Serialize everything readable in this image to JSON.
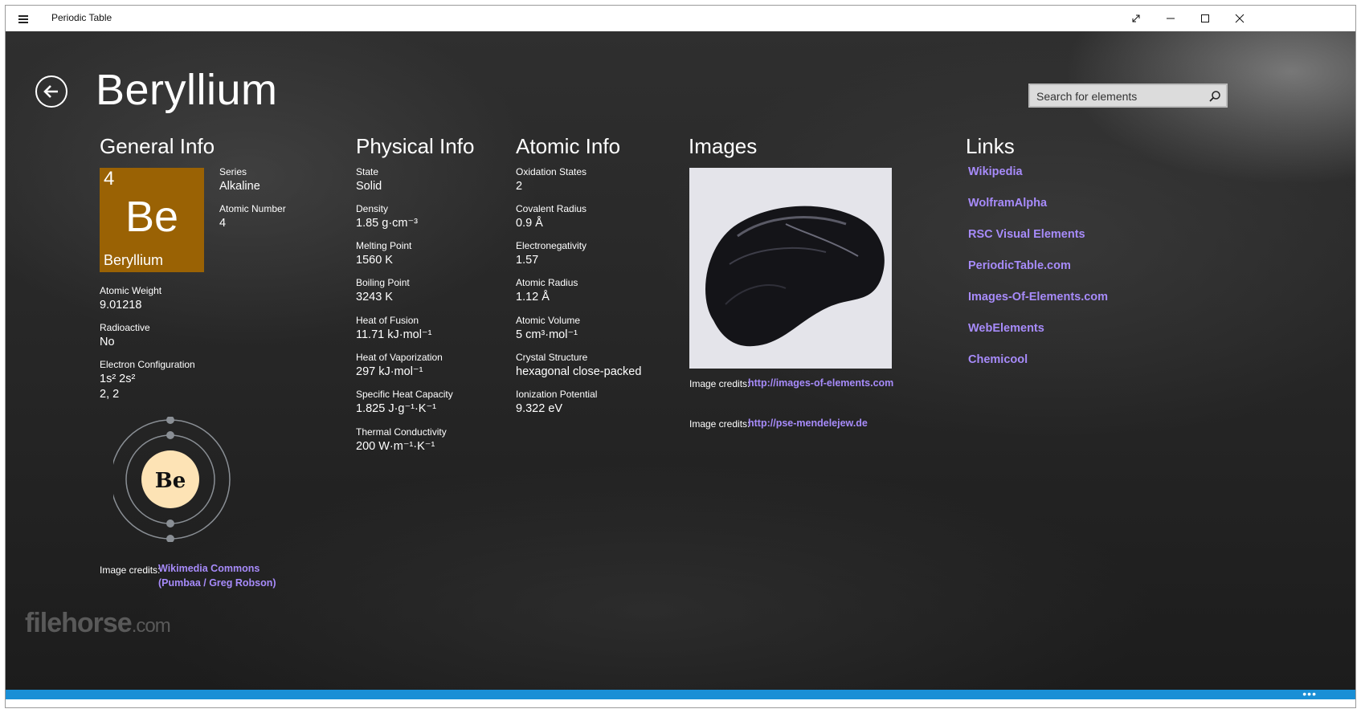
{
  "window": {
    "title": "Periodic Table"
  },
  "page": {
    "title": "Beryllium"
  },
  "search": {
    "placeholder": "Search for elements"
  },
  "sections": {
    "general": "General Info",
    "physical": "Physical Info",
    "atomic": "Atomic Info",
    "images": "Images",
    "links": "Links"
  },
  "tile": {
    "number": "4",
    "symbol": "Be",
    "name": "Beryllium",
    "color": "#9a6204"
  },
  "general": {
    "series_label": "Series",
    "series": "Alkaline",
    "atomic_number_label": "Atomic Number",
    "atomic_number": "4",
    "atomic_weight_label": "Atomic Weight",
    "atomic_weight": "9.01218",
    "radioactive_label": "Radioactive",
    "radioactive": "No",
    "electron_config_label": "Electron Configuration",
    "electron_config": "1s² 2s²",
    "shells": "2, 2"
  },
  "bohr": {
    "symbol": "Be"
  },
  "bohr_credit": {
    "label": "Image credits:",
    "line1": "Wikimedia Commons",
    "line2": "(Pumbaa / Greg Robson)"
  },
  "physical": [
    {
      "label": "State",
      "value": "Solid"
    },
    {
      "label": "Density",
      "value": "1.85 g·cm⁻³"
    },
    {
      "label": "Melting Point",
      "value": "1560 K"
    },
    {
      "label": "Boiling Point",
      "value": "3243 K"
    },
    {
      "label": "Heat of Fusion",
      "value": "11.71 kJ·mol⁻¹"
    },
    {
      "label": "Heat of Vaporization",
      "value": "297 kJ·mol⁻¹"
    },
    {
      "label": "Specific Heat Capacity",
      "value": "1.825 J·g⁻¹·K⁻¹"
    },
    {
      "label": "Thermal Conductivity",
      "value": "200 W·m⁻¹·K⁻¹"
    }
  ],
  "atomic": [
    {
      "label": "Oxidation States",
      "value": "2"
    },
    {
      "label": "Covalent Radius",
      "value": "0.9 Å"
    },
    {
      "label": "Electronegativity",
      "value": "1.57"
    },
    {
      "label": "Atomic Radius",
      "value": "1.12 Å"
    },
    {
      "label": "Atomic Volume",
      "value": "5 cm³·mol⁻¹"
    },
    {
      "label": "Crystal Structure",
      "value": "hexagonal close-packed"
    },
    {
      "label": "Ionization Potential",
      "value": "9.322 eV"
    }
  ],
  "images": {
    "credit1_label": "Image credits:",
    "credit1_link": "http://images-of-elements.com",
    "credit2_label": "Image credits:",
    "credit2_link": "http://pse-mendelejew.de"
  },
  "links": [
    "Wikipedia",
    "WolframAlpha",
    "RSC Visual Elements",
    "PeriodicTable.com",
    "Images-Of-Elements.com",
    "WebElements",
    "Chemicool"
  ],
  "watermark": {
    "main": "filehorse",
    "suffix": ".com"
  },
  "colors": {
    "accent": "#1a8fd6",
    "link": "#a78bfa",
    "background": "#262626"
  }
}
